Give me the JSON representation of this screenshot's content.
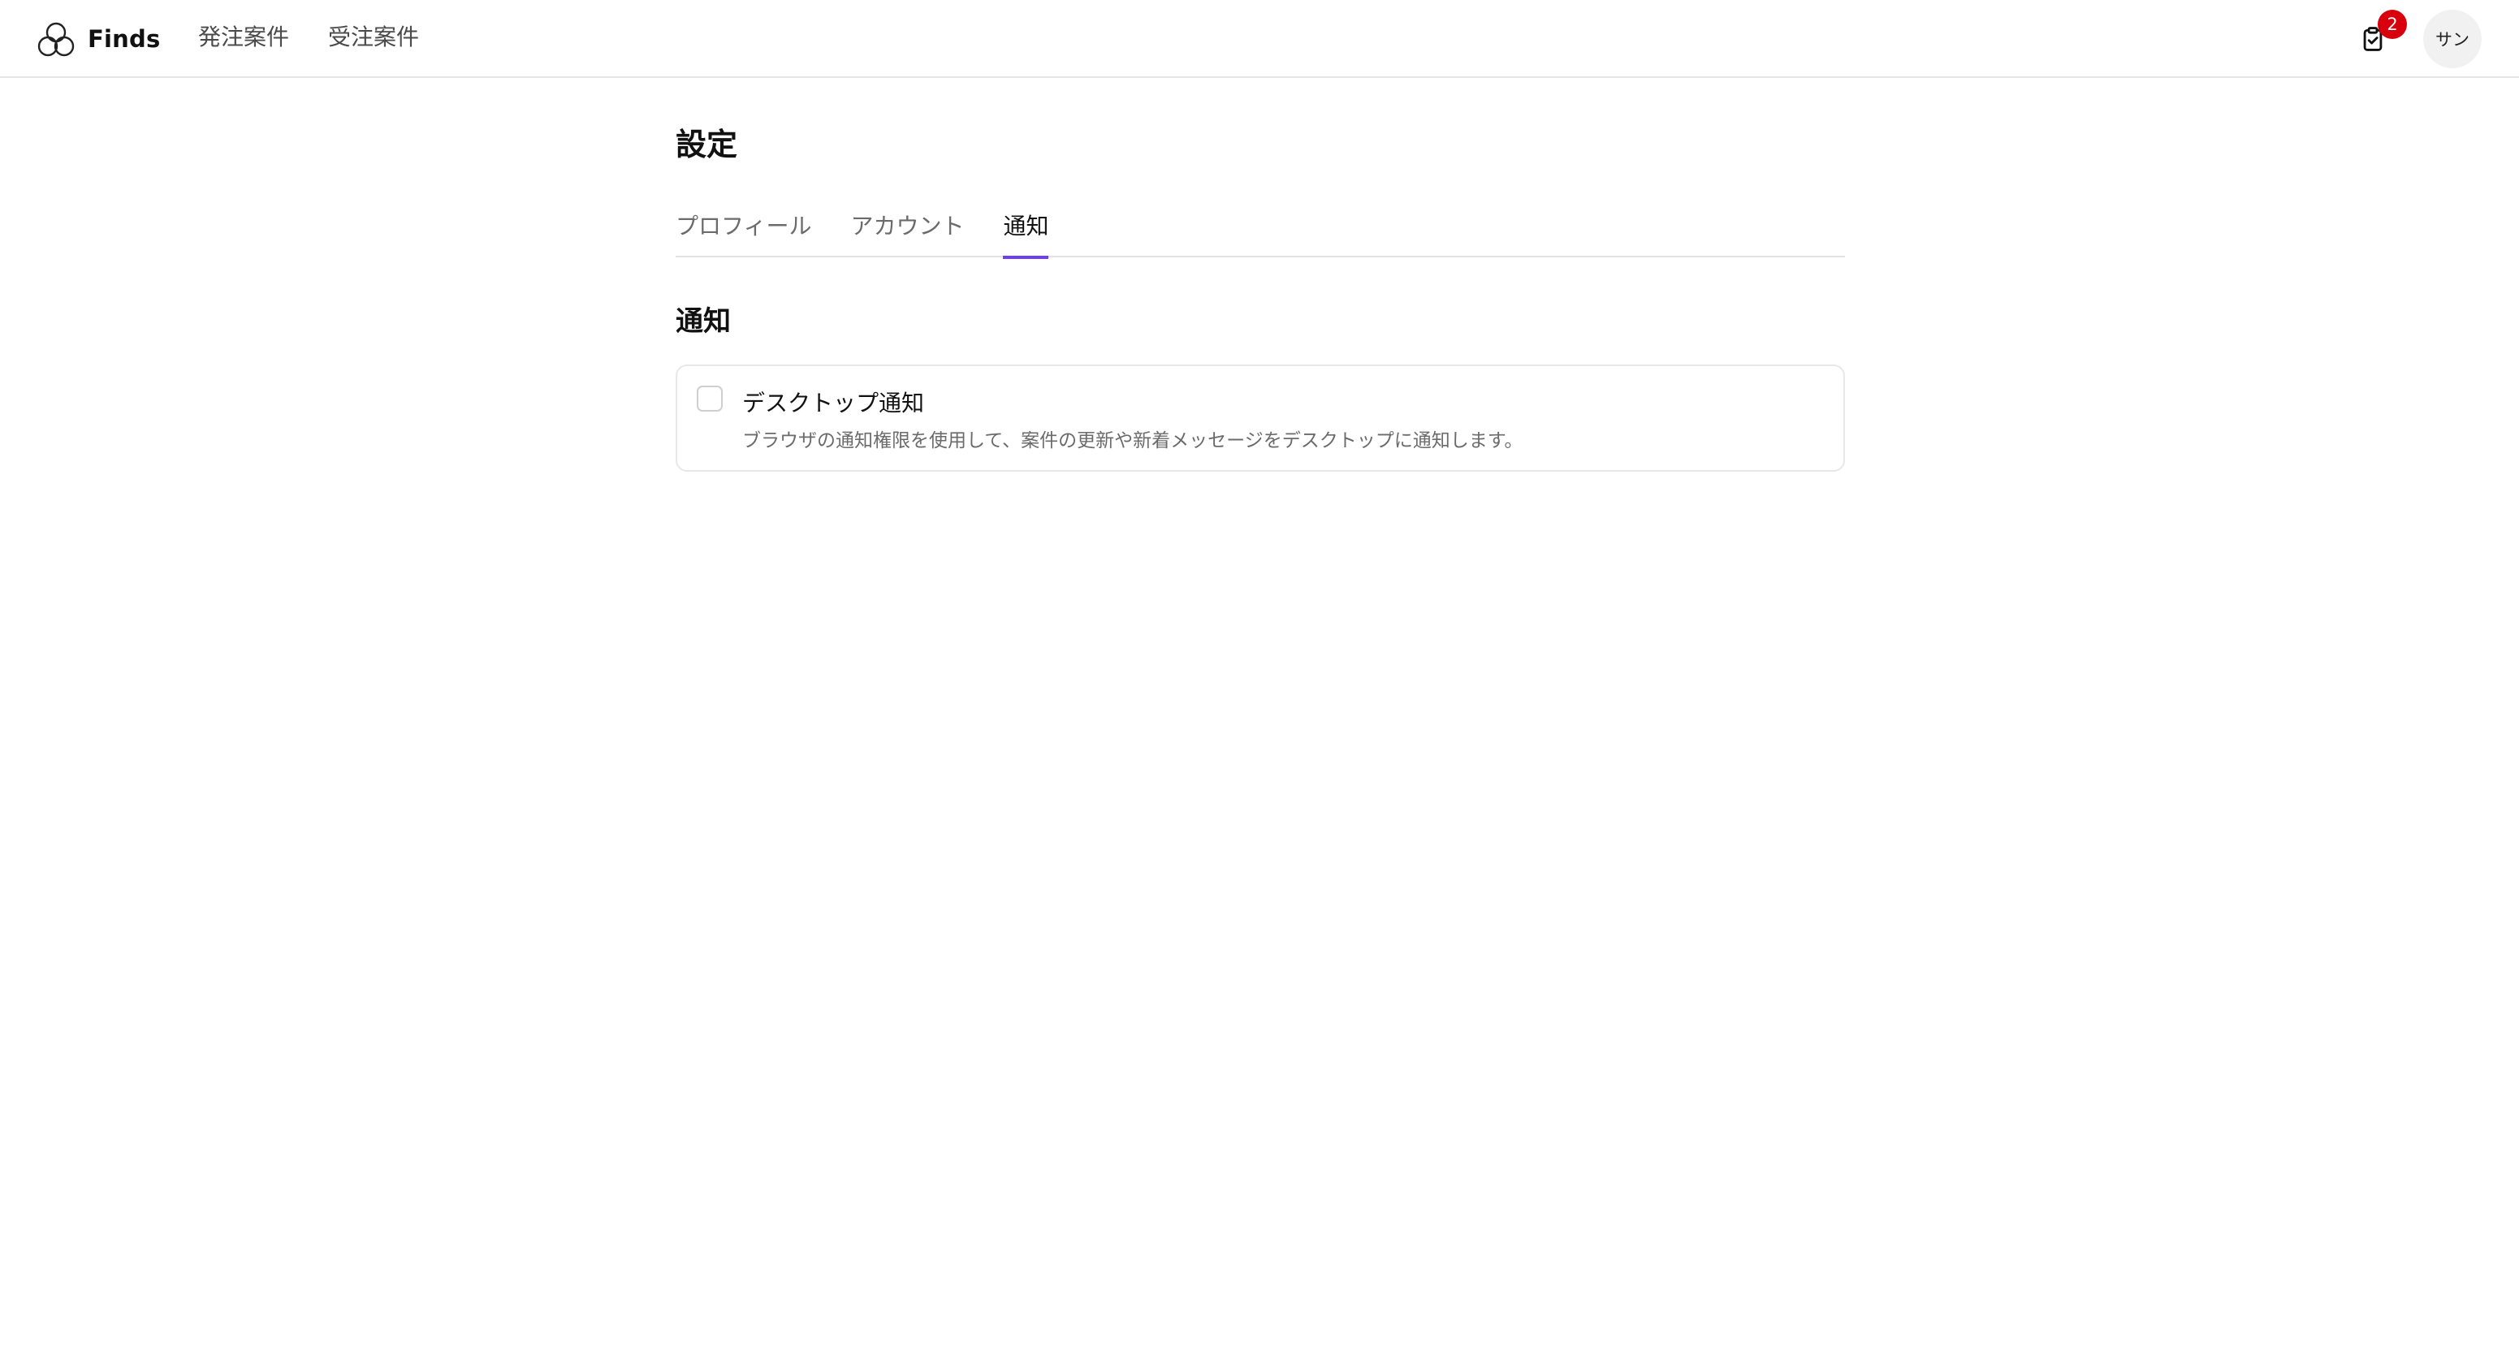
{
  "header": {
    "brand": "Finds",
    "nav": [
      {
        "label": "発注案件"
      },
      {
        "label": "受注案件"
      }
    ],
    "task_badge": "2",
    "avatar_text": "サン"
  },
  "page": {
    "title": "設定",
    "tabs": [
      {
        "label": "プロフィール",
        "active": false
      },
      {
        "label": "アカウント",
        "active": false
      },
      {
        "label": "通知",
        "active": true
      }
    ],
    "section_title": "通知",
    "options": [
      {
        "label": "デスクトップ通知",
        "description": "ブラウザの通知権限を使用して、案件の更新や新着メッセージをデスクトップに通知します。",
        "checked": false
      }
    ]
  },
  "colors": {
    "accent": "#6d3ff0",
    "badge": "#d9000d",
    "border": "#e8e8e8"
  },
  "icons": {
    "logo": "three-circles-logo-icon",
    "tasks": "clipboard-check-icon"
  }
}
